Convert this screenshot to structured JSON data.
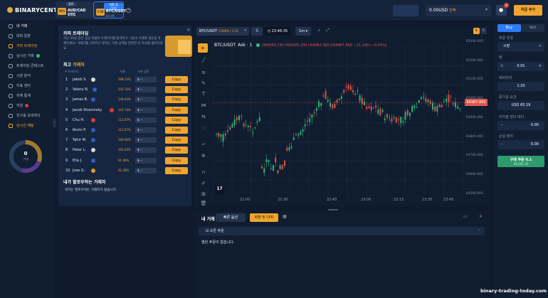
{
  "logo": "BINARYCENT",
  "tabs": [
    {
      "header": "종료",
      "name": "AUD/CAD OTC",
      "value": "96.00",
      "pct": "99%"
    },
    {
      "header": "외환 및 CFD",
      "name": "BTC/USDT",
      "value": "85.99",
      "pct": "5.98"
    }
  ],
  "header": {
    "balance": "0.00USD",
    "balance_label": "잔액",
    "deposit_label": "자금 추가",
    "notif_count": "9"
  },
  "sidebar": {
    "items": [
      "내 거래",
      "대회 입장",
      "카피 트레이딩",
      "상시선 거래",
      "트레이딩 콘테스트",
      "시장 분석",
      "지표 센터",
      "자체 통계",
      "지원",
      "친구를 초대하다",
      "상시선 채팅"
    ],
    "gauge_value": "0",
    "gauge_label": "거래"
  },
  "panel": {
    "title": "카피 트레이딩",
    "desc": "지난 30일 동안 성공 비율이 트레이더를 탐색하고 그들의 거래와 성공을 복제하세요! 거래자를 선택하고 원하는 거래 금액을 입력한 후 복사를 클릭하세요.",
    "section": "최고",
    "section_link": "거래자",
    "col_name": "# 트레이더",
    "col_rate": "비율",
    "col_amount": "거래 금액",
    "traders": [
      {
        "rank": "1",
        "name": "Jakob S.",
        "rate": "298.33%",
        "amount": "$ --"
      },
      {
        "rank": "2",
        "name": "Valery N.",
        "rate": "242.74%",
        "amount": "$ --"
      },
      {
        "rank": "3",
        "name": "James B.",
        "rate": "149.43%",
        "amount": "$ --"
      },
      {
        "rank": "4",
        "name": "Jacob Stravinsky",
        "rate": "141.74%",
        "amount": "$ --"
      },
      {
        "rank": "5",
        "name": "Chu H.",
        "rate": "112.67%",
        "amount": "$ --"
      },
      {
        "rank": "6",
        "name": "Kevin P.",
        "rate": "112.07%",
        "amount": "$ --"
      },
      {
        "rank": "7",
        "name": "Tahir M.",
        "rate": "109.90%",
        "amount": "$ --"
      },
      {
        "rank": "8",
        "name": "Peter L.",
        "rate": "102.24%",
        "amount": "$ --"
      },
      {
        "rank": "9",
        "name": "Ella J.",
        "rate": "91.46%",
        "amount": "$ --"
      },
      {
        "rank": "10",
        "name": "Jose G.",
        "rate": "91.26%",
        "amount": "$ --"
      }
    ],
    "copy_label": "Copy",
    "following_title": "내가 팔로우하는 거래자",
    "following_empty": "귀하는 팔로우하는 거래자가 없습니다."
  },
  "chart": {
    "pair": "BTC/USDT",
    "pair_value": "1.000% / 1.10",
    "time": "23:46:35",
    "interval": "1m",
    "title": "BTC/USDT_Ask · 1",
    "ohlc": "O65003.190 H65005.230 L64982.360 C64987.890 −21.140 (−0.03%)",
    "price_tag": "64987.890",
    "yticks": [
      "65300.000",
      "65200.000",
      "65100.000",
      "65000.000",
      "64900.000",
      "64800.000",
      "64700.000",
      "64600.000",
      "64500.000"
    ],
    "xticks": [
      "22:00",
      "22:30",
      "22:45",
      "23:00",
      "23:15",
      "23:30",
      "23:45"
    ]
  },
  "right": {
    "buy": "Buy",
    "sell": "Sell",
    "type_label": "주문 유형",
    "type_value": "시장",
    "amount_label": "랏",
    "amount_value": "0.01",
    "leverage_label": "레버리지",
    "leverage_value": "1:10",
    "margin_label": "증거금 요건",
    "margin_value": "USD 65.19",
    "tp_label": "이익을 얻다 따다",
    "tp_value": "0.00",
    "sl_label": "손실 정지",
    "sl_value": "0.00",
    "submit": "구매 주문 0.1",
    "submit_sub": "65,001.35"
  },
  "bottom": {
    "title": "내 거래",
    "tab1": "빠른 옵션",
    "tab2": "외환 및 CFD",
    "section": "오픈 주문",
    "empty": "열린 주문이 없습니다."
  },
  "watermark": "binary-trading-today.com"
}
